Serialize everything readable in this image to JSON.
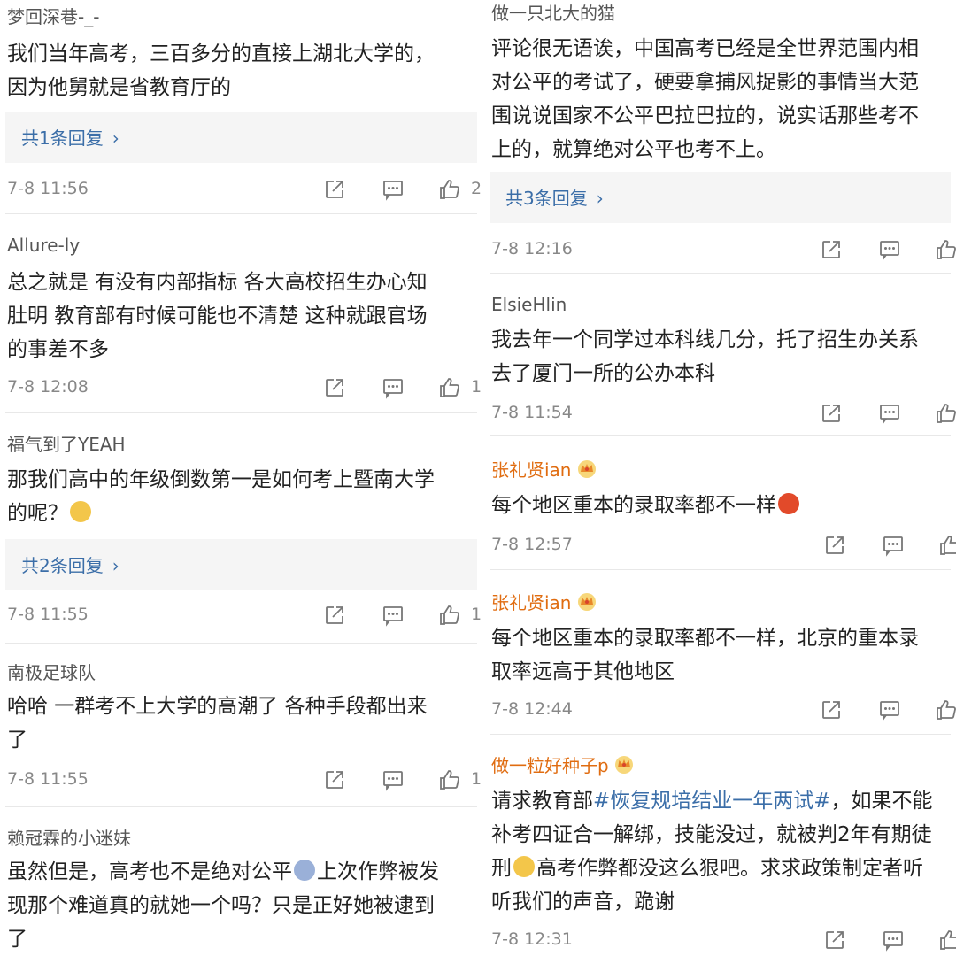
{
  "left": [
    {
      "user": "梦回深巷-_-",
      "lines": [
        "我们当年高考，三百多分的直接上湖北大学的，",
        "因为他舅就是省教育厅的"
      ],
      "replies": "共1条回复",
      "time": "7-8 11:56",
      "likes": "2"
    },
    {
      "user": "Allure-ly",
      "lines": [
        "总之就是  有没有内部指标  各大高校招生办心知",
        "肚明  教育部有时候可能也不清楚  这种就跟官场",
        "的事差不多"
      ],
      "time": "7-8 12:08",
      "likes": "1"
    },
    {
      "user": "福气到了YEAH",
      "lines": [
        "那我们高中的年级倒数第一是如何考上暨南大学",
        "的呢？"
      ],
      "replies": "共2条回复",
      "time": "7-8 11:55",
      "likes": "1"
    },
    {
      "user": "南极足球队",
      "lines": [
        "哈哈  一群考不上大学的高潮了  各种手段都出来",
        "了"
      ],
      "time": "7-8 11:55",
      "likes": "1"
    },
    {
      "user": "赖冠霖的小迷妹",
      "lines": [
        "虽然但是，高考也不是绝对公平",
        "上次作弊被发",
        "现那个难道真的就她一个吗？只是正好她被逮到",
        "了"
      ]
    }
  ],
  "right": [
    {
      "user": "做一只北大的猫",
      "lines": [
        "评论很无语诶，中国高考已经是全世界范围内相",
        "对公平的考试了，硬要拿捕风捉影的事情当大范",
        "围说说国家不公平巴拉巴拉的，说实话那些考不",
        "上的，就算绝对公平也考不上。"
      ],
      "replies": "共3条回复",
      "time": "7-8 12:16"
    },
    {
      "user": "ElsieHlin",
      "lines": [
        "我去年一个同学过本科线几分，托了招生办关系",
        "去了厦门一所的公办本科"
      ],
      "time": "7-8 11:54"
    },
    {
      "user": "张礼贤ian",
      "lines": [
        "每个地区重本的录取率都不一样"
      ],
      "time": "7-8 12:57"
    },
    {
      "user": "张礼贤ian",
      "lines": [
        "每个地区重本的录取率都不一样，北京的重本录",
        "取率远高于其他地区"
      ],
      "time": "7-8 12:44"
    },
    {
      "user": "做一粒好种子p",
      "lines": [
        "请求教育部",
        "，如果不能",
        "补考四证合一解绑，技能没过，就被判2年有期徒",
        "高考作弊都没这么狠吧。求求政策制定者听",
        "听我们的声音，跪谢"
      ],
      "hashtag": "#恢复规培结业一年两试#",
      "prefix3": "刑",
      "time": "7-8 12:31"
    }
  ],
  "colors": {
    "link": "#3b6ea8",
    "vip": "#e06c10",
    "text": "#222222",
    "meta": "#888888",
    "reply_bg": "#f5f5f5"
  },
  "icons": [
    "share-icon",
    "comment-icon",
    "like-icon",
    "crown-icon",
    "emoji-icon",
    "chevron-right-icon"
  ]
}
